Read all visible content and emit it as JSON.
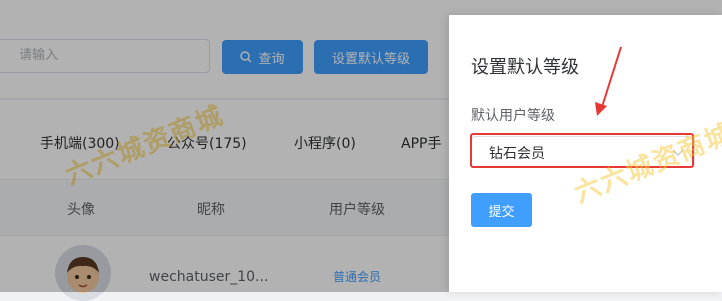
{
  "toolbar": {
    "search_placeholder": "请输入",
    "search_button_label": "查询",
    "default_level_button_label": "设置默认等级"
  },
  "tabs": [
    {
      "label": "手机端(300)"
    },
    {
      "label": "公众号(175)"
    },
    {
      "label": "小程序(0)"
    },
    {
      "label": "APP手"
    }
  ],
  "table": {
    "headers": [
      "头像",
      "昵称",
      "用户等级"
    ],
    "rows": [
      {
        "nickname": "wechatuser_10...",
        "level": "普通会员"
      }
    ]
  },
  "watermark": {
    "text": "六六城资商城"
  },
  "dialog": {
    "title": "设置默认等级",
    "field_label": "默认用户等级",
    "selected_level": "钻石会员",
    "submit_label": "提交"
  },
  "colors": {
    "primary": "#409eff",
    "highlight": "#e53935",
    "watermark": "#f5c83c"
  }
}
